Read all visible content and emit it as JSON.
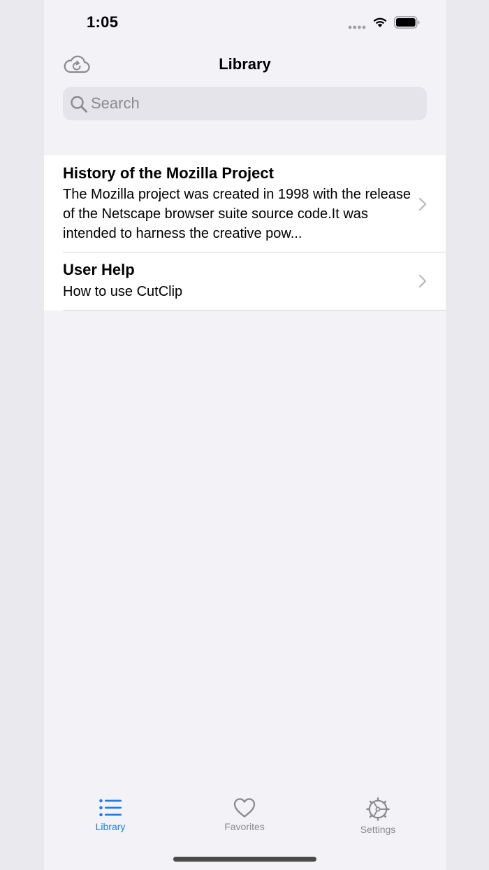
{
  "status_bar": {
    "time": "1:05"
  },
  "nav": {
    "title": "Library",
    "sync_icon": "cloud-sync-icon"
  },
  "search": {
    "placeholder": "Search",
    "value": ""
  },
  "library_items": [
    {
      "title": "History of the Mozilla Project",
      "subtitle": "The Mozilla project was created in 1998 with the release of the Netscape browser suite source code.It was intended to harness the creative pow..."
    },
    {
      "title": "User Help",
      "subtitle": "How to use CutClip"
    }
  ],
  "tab_bar": {
    "tabs": [
      {
        "label": "Library",
        "icon": "list-icon",
        "active": true
      },
      {
        "label": "Favorites",
        "icon": "heart-icon",
        "active": false
      },
      {
        "label": "Settings",
        "icon": "gear-icon",
        "active": false
      }
    ]
  },
  "colors": {
    "accent": "#1E7CF2",
    "background": "#F2F2F7",
    "inactive": "#8A8A8E"
  }
}
